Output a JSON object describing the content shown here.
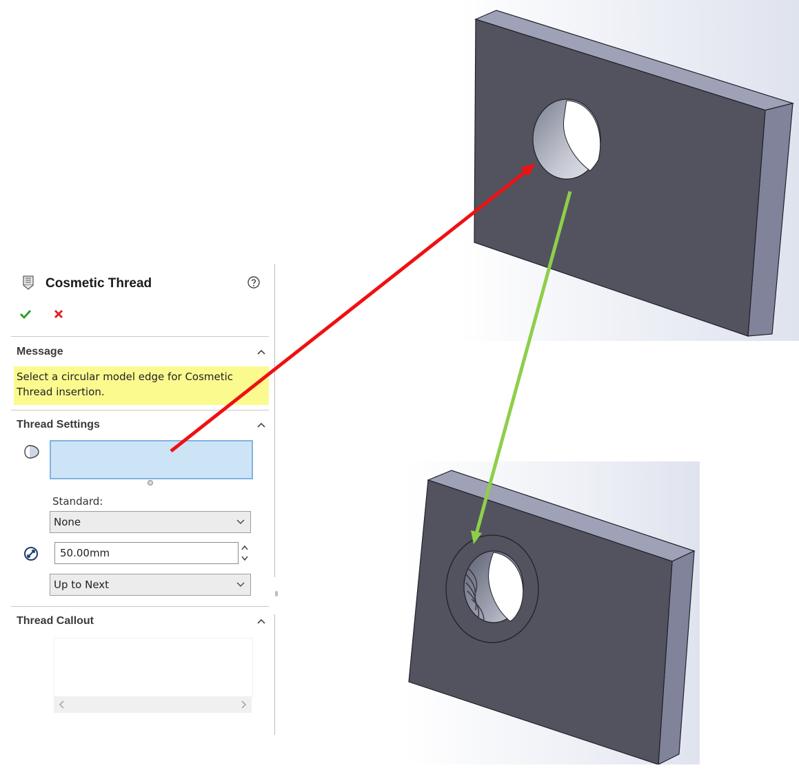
{
  "panel": {
    "title": "Cosmetic Thread",
    "icons": {
      "feature": "cosmetic-thread-icon",
      "help": "help-icon",
      "ok": "checkmark-icon",
      "cancel": "close-icon"
    },
    "colors": {
      "ok": "#2e9e2e",
      "cancel": "#e02020",
      "message_bg": "#fbfa8f",
      "selection_bg": "#cde4f7"
    }
  },
  "message": {
    "title": "Message",
    "text": "Select a circular model edge for Cosmetic Thread insertion."
  },
  "thread_settings": {
    "title": "Thread Settings",
    "edge_selection_value": "",
    "standard_label": "Standard:",
    "standard_value": "None",
    "diameter_value": "50.00mm",
    "end_condition_value": "Up to Next"
  },
  "thread_callout": {
    "title": "Thread Callout",
    "value": ""
  },
  "annotations": {
    "arrow_red_color": "#ee1111",
    "arrow_green_color": "#8ecf4a"
  }
}
